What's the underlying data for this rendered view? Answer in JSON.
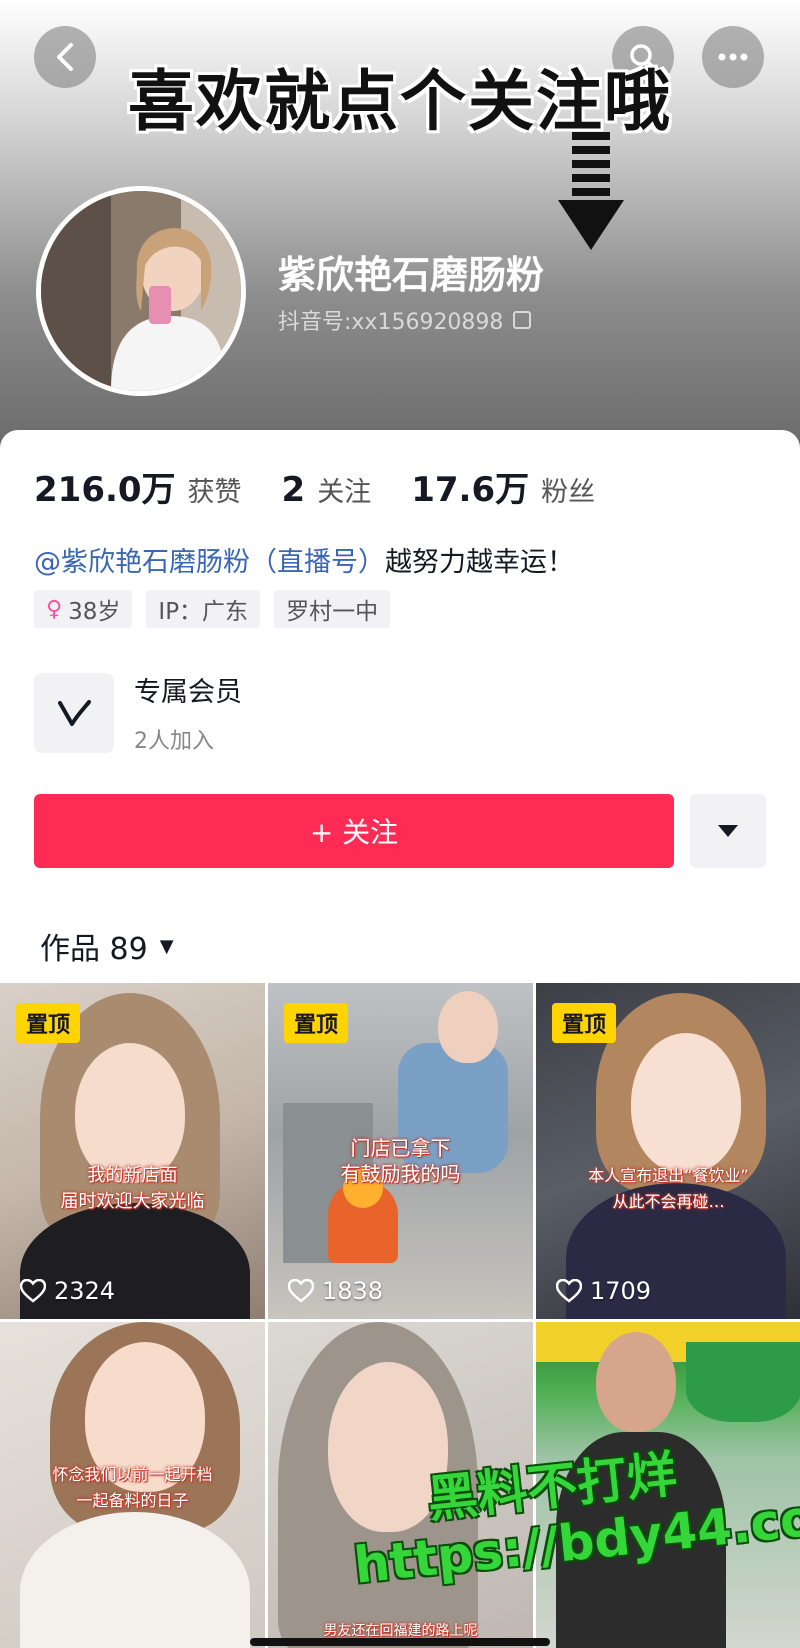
{
  "header": {
    "banner_text": "喜欢就点个关注哦",
    "name": "紫欣艳石磨肠粉",
    "douyin_id": "抖音号:xx156920898"
  },
  "stats": [
    {
      "num": "216.0万",
      "label": "获赞"
    },
    {
      "num": "2",
      "label": "关注"
    },
    {
      "num": "17.6万",
      "label": "粉丝"
    }
  ],
  "bio": {
    "mention": "@紫欣艳石磨肠粉（直播号）",
    "text": "越努力越幸运！"
  },
  "tags": {
    "age": "38岁",
    "ip": "IP：广东",
    "school": "罗村一中"
  },
  "member": {
    "title": "专属会员",
    "subtitle": "2人加入"
  },
  "follow_label": "+ 关注",
  "works_label": "作品 89",
  "videos": [
    {
      "pinned": "置顶",
      "caption": "我的新店面\n届时欢迎大家光临",
      "likes": "2324"
    },
    {
      "pinned": "置顶",
      "caption": "门店已拿下\n有鼓励我的吗",
      "likes": "1838"
    },
    {
      "pinned": "置顶",
      "caption": "本人宣布退出“餐饮业”\n从此不会再碰…",
      "likes": "1709"
    },
    {
      "caption": "怀念我们以前一起开档\n一起备料的日子"
    },
    {
      "caption": "男友还在回福建的路上呢"
    },
    {
      "caption": ""
    }
  ],
  "watermark": {
    "line1": "黑料不打烊",
    "line2": "https://bdy44.co"
  },
  "colors": {
    "follow": "#fe2c55",
    "pin": "#ffd400",
    "mention": "#3a67b3",
    "watermark": "#35d63a"
  }
}
